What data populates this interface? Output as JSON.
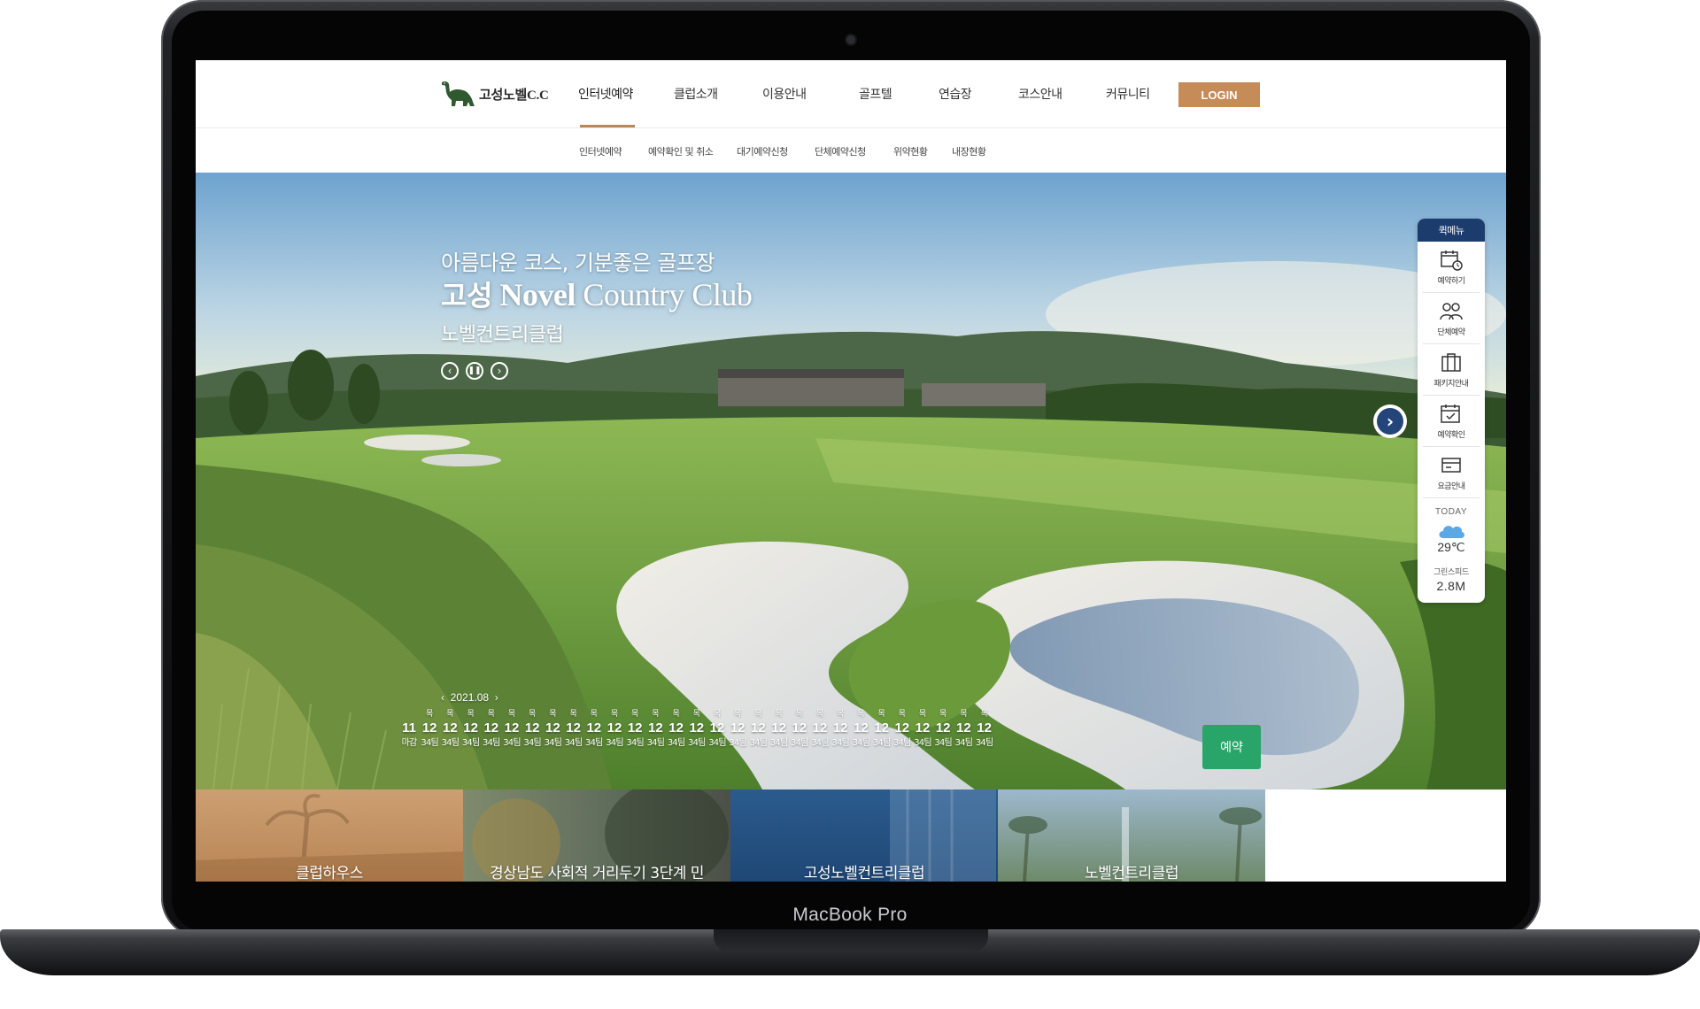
{
  "device": {
    "label": "MacBook Pro"
  },
  "header": {
    "logo_text": "고성노벨C.C",
    "nav": [
      "인터넷예약",
      "클럽소개",
      "이용안내",
      "골프텔",
      "연습장",
      "코스안내",
      "커뮤니티"
    ],
    "login_label": "LOGIN"
  },
  "subnav": [
    "인터넷예약",
    "예약확인 및 취소",
    "대기예약신청",
    "단체예약신청",
    "위약현황",
    "내장현황"
  ],
  "hero": {
    "subtitle": "아름다운 코스, 기분좋은 골프장",
    "title_prefix": "고성",
    "title_bold": "Novel",
    "title_rest": "Country Club",
    "name": "노벨컨트리클럽"
  },
  "quick_menu": {
    "title": "퀵메뉴",
    "items": [
      {
        "label": "예약하기",
        "icon": "calendar-clock-icon"
      },
      {
        "label": "단체예약",
        "icon": "group-icon"
      },
      {
        "label": "패키지안내",
        "icon": "package-icon"
      },
      {
        "label": "예약확인",
        "icon": "calendar-check-icon"
      },
      {
        "label": "요금안내",
        "icon": "fee-card-icon"
      }
    ],
    "today_label": "TODAY",
    "temperature": "29℃",
    "green_speed_label": "그린스피드",
    "green_speed_value": "2.8M"
  },
  "calendar": {
    "month": "2021.08",
    "days": [
      {
        "day": "",
        "date": "11",
        "slot": "마감"
      },
      {
        "day": "목",
        "date": "12",
        "slot": "34팀"
      },
      {
        "day": "목",
        "date": "12",
        "slot": "34팀"
      },
      {
        "day": "목",
        "date": "12",
        "slot": "34팀"
      },
      {
        "day": "목",
        "date": "12",
        "slot": "34팀"
      },
      {
        "day": "목",
        "date": "12",
        "slot": "34팀"
      },
      {
        "day": "목",
        "date": "12",
        "slot": "34팀"
      },
      {
        "day": "목",
        "date": "12",
        "slot": "34팀"
      },
      {
        "day": "목",
        "date": "12",
        "slot": "34팀"
      },
      {
        "day": "목",
        "date": "12",
        "slot": "34팀"
      },
      {
        "day": "목",
        "date": "12",
        "slot": "34팀"
      },
      {
        "day": "목",
        "date": "12",
        "slot": "34팀"
      },
      {
        "day": "목",
        "date": "12",
        "slot": "34팀"
      },
      {
        "day": "목",
        "date": "12",
        "slot": "34팀"
      },
      {
        "day": "목",
        "date": "12",
        "slot": "34팀"
      },
      {
        "day": "목",
        "date": "12",
        "slot": "34팀"
      },
      {
        "day": "목",
        "date": "12",
        "slot": "34팀"
      },
      {
        "day": "목",
        "date": "12",
        "slot": "34팀"
      },
      {
        "day": "목",
        "date": "12",
        "slot": "34팀"
      },
      {
        "day": "목",
        "date": "12",
        "slot": "34팀"
      },
      {
        "day": "목",
        "date": "12",
        "slot": "34팀"
      },
      {
        "day": "목",
        "date": "12",
        "slot": "34팀"
      },
      {
        "day": "목",
        "date": "12",
        "slot": "34팀"
      },
      {
        "day": "목",
        "date": "12",
        "slot": "34팀"
      },
      {
        "day": "목",
        "date": "12",
        "slot": "34팀"
      },
      {
        "day": "목",
        "date": "12",
        "slot": "34팀"
      },
      {
        "day": "목",
        "date": "12",
        "slot": "34팀"
      },
      {
        "day": "목",
        "date": "12",
        "slot": "34팀"
      },
      {
        "day": "목",
        "date": "12",
        "slot": "34팀"
      }
    ],
    "reserve_label": "예약"
  },
  "cards": [
    {
      "title": "클럽하우스",
      "color": "#c8996a"
    },
    {
      "title": "경상남도 사회적 거리두기 3단계 민",
      "color": "#6f7a72"
    },
    {
      "title": "고성노벨컨트리클럽",
      "color": "#2a5a8c"
    },
    {
      "title": "노벨컨트리클럽",
      "color": "#7f9fb8"
    }
  ]
}
